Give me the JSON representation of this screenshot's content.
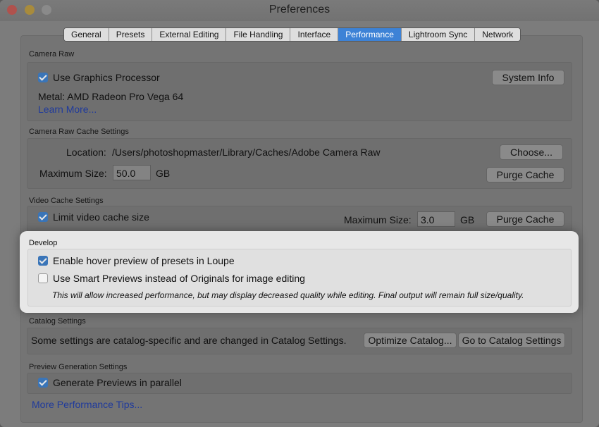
{
  "window": {
    "title": "Preferences"
  },
  "tabs": [
    {
      "label": "General",
      "active": false
    },
    {
      "label": "Presets",
      "active": false
    },
    {
      "label": "External Editing",
      "active": false
    },
    {
      "label": "File Handling",
      "active": false
    },
    {
      "label": "Interface",
      "active": false
    },
    {
      "label": "Performance",
      "active": true
    },
    {
      "label": "Lightroom Sync",
      "active": false
    },
    {
      "label": "Network",
      "active": false
    }
  ],
  "camera_raw": {
    "section_title": "Camera Raw",
    "use_gpu_label": "Use Graphics Processor",
    "use_gpu_checked": true,
    "system_info_button": "System Info",
    "metal_text": "Metal: AMD Radeon Pro Vega 64",
    "learn_more_link": "Learn More..."
  },
  "cache_settings": {
    "section_title": "Camera Raw Cache Settings",
    "location_label": "Location:",
    "location_path": "/Users/photoshopmaster/Library/Caches/Adobe Camera Raw",
    "choose_button": "Choose...",
    "max_size_label": "Maximum Size:",
    "max_size_value": "50.0",
    "unit": "GB",
    "purge_button": "Purge Cache"
  },
  "video_cache": {
    "section_title": "Video Cache Settings",
    "limit_label": "Limit video cache size",
    "limit_checked": true,
    "max_size_label": "Maximum Size:",
    "max_size_value": "3.0",
    "unit": "GB",
    "purge_button": "Purge Cache"
  },
  "develop": {
    "section_title": "Develop",
    "hover_preview_label": "Enable hover preview of presets in Loupe",
    "hover_preview_checked": true,
    "smart_previews_label": "Use Smart Previews instead of Originals for image editing",
    "smart_previews_checked": false,
    "note": "This will allow increased performance, but may display decreased quality while editing. Final output will remain full size/quality."
  },
  "catalog": {
    "section_title": "Catalog Settings",
    "description": "Some settings are catalog-specific and are changed in Catalog Settings.",
    "optimize_button": "Optimize Catalog...",
    "goto_button": "Go to Catalog Settings"
  },
  "preview_generation": {
    "section_title": "Preview Generation Settings",
    "parallel_label": "Generate Previews in parallel",
    "parallel_checked": true
  },
  "more_tips_link": "More Performance Tips...",
  "colors": {
    "accent": "#3d82d6",
    "link": "#1f3a9c",
    "highlight_bg": "#e7e7e7"
  }
}
